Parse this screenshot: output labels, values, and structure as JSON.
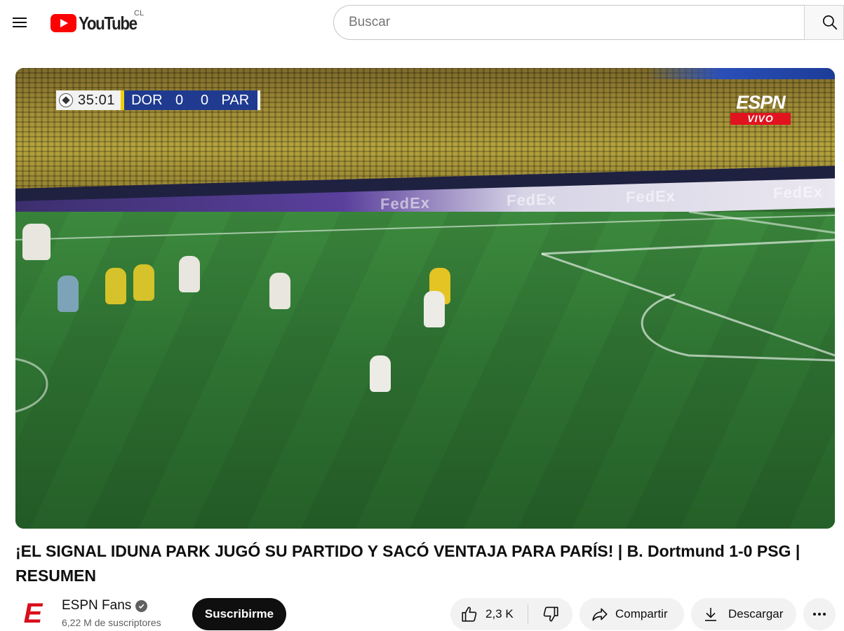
{
  "masthead": {
    "logo_text": "YouTube",
    "country_code": "CL",
    "search_placeholder": "Buscar"
  },
  "player": {
    "scorebug": {
      "clock": "35:01",
      "home_team": "DOR",
      "home_score": "0",
      "away_score": "0",
      "away_team": "PAR"
    },
    "broadcaster": {
      "logo": "ESPN",
      "live_label": "VIVO"
    }
  },
  "video": {
    "title": "¡EL SIGNAL IDUNA PARK JUGÓ SU PARTIDO Y SACÓ VENTAJA PARA PARÍS! | B. Dortmund 1-0 PSG | RESUMEN"
  },
  "channel": {
    "avatar_letter": "E",
    "name": "ESPN Fans",
    "subscribers": "6,22 M de suscriptores",
    "subscribe_label": "Suscribirme"
  },
  "actions": {
    "like_count": "2,3 K",
    "share_label": "Compartir",
    "download_label": "Descargar"
  },
  "icons": {
    "menu": "menu-icon",
    "search": "search-icon",
    "like": "thumbs-up-icon",
    "dislike": "thumbs-down-icon",
    "share": "share-arrow-icon",
    "download": "download-icon",
    "more": "more-horizontal-icon",
    "verified": "verified-check-icon"
  },
  "colors": {
    "brand_red": "#ff0000",
    "espn_red": "#e1131f",
    "scorebug_blue": "#1f3a8f",
    "scorebug_yellow": "#f5d000",
    "pill_bg": "#f2f2f2",
    "subscribe_bg": "#0f0f0f"
  }
}
